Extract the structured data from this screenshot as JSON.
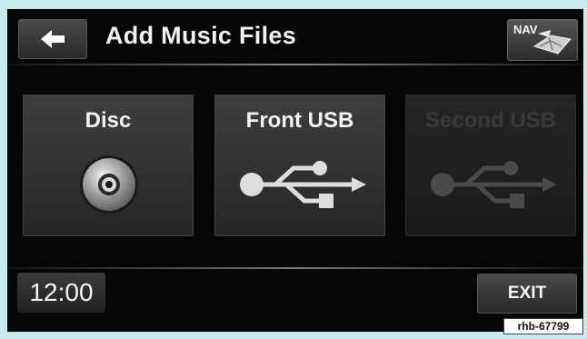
{
  "header": {
    "title": "Add Music Files",
    "nav_label": "NAV"
  },
  "sources": [
    {
      "label": "Disc",
      "icon": "disc-icon",
      "enabled": true
    },
    {
      "label": "Front USB",
      "icon": "usb-icon",
      "enabled": true
    },
    {
      "label": "Second USB",
      "icon": "usb-icon",
      "enabled": false
    }
  ],
  "footer": {
    "clock": "12:00",
    "exit_label": "EXIT"
  },
  "reference_tag": "rhb-67799",
  "colors": {
    "frame_background": "#c9ecef",
    "screen_background": "#060606",
    "text": "#f2f2f2",
    "disabled_text": "#3a3a3a"
  }
}
